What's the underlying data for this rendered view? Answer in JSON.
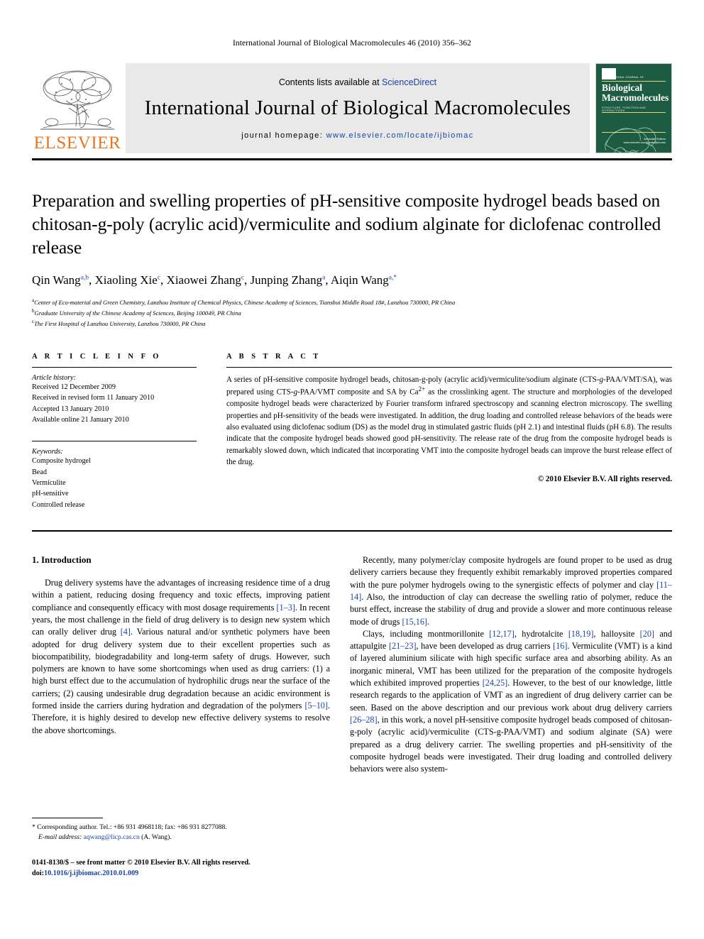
{
  "running_head": "International Journal of Biological Macromolecules 46 (2010) 356–362",
  "masthead": {
    "elsevier_wordmark": "ELSEVIER",
    "contents_prefix": "Contents lists available at ",
    "sciencedirect": "ScienceDirect",
    "journal_title": "International Journal of Biological Macromolecules",
    "homepage_prefix": "journal homepage: ",
    "homepage_url": "www.elsevier.com/locate/ijbiomac",
    "cover": {
      "top_line": "INTERNATIONAL JOURNAL OF",
      "name_line1": "Biological",
      "name_line2": "Macromolecules",
      "subtitle": "STRUCTURE, FUNCTION AND INTERACTIONS",
      "footer_line1": "Associate Editors",
      "footer_line2": "www.elsevier.com/locate/ijbiomac"
    },
    "accent_orange": "#E87722",
    "link_blue": "#1a43a8",
    "band_gray": "#e9e9e9",
    "cover_green": "#1d5c42"
  },
  "article": {
    "title": "Preparation and swelling properties of pH-sensitive composite hydrogel beads based on chitosan-g-poly (acrylic acid)/vermiculite and sodium alginate for diclofenac controlled release",
    "authors_html": "Qin Wang<sup>a,b</sup>, Xiaoling Xie<sup>c</sup>, Xiaowei Zhang<sup>c</sup>, Junping Zhang<sup>a</sup>, Aiqin Wang<sup>a,</sup><sup>*</sup>",
    "affiliations": [
      {
        "marker": "a",
        "text": "Center of Eco-material and Green Chemistry, Lanzhou Institute of Chemical Physics, Chinese Academy of Sciences, Tianshui Middle Road 18#, Lanzhou 730000, PR China"
      },
      {
        "marker": "b",
        "text": "Graduate University of the Chinese Academy of Sciences, Beijing 100049, PR China"
      },
      {
        "marker": "c",
        "text": "The First Hospital of Lanzhou University, Lanzhou 730000, PR China"
      }
    ]
  },
  "article_info": {
    "heading": "A R T I C L E    I N F O",
    "history_label": "Article history:",
    "history": [
      "Received 12 December 2009",
      "Received in revised form 11 January 2010",
      "Accepted 13 January 2010",
      "Available online 21 January 2010"
    ],
    "keywords_label": "Keywords:",
    "keywords": [
      "Composite hydrogel",
      "Bead",
      "Vermiculite",
      "pH-sensitive",
      "Controlled release"
    ]
  },
  "abstract": {
    "heading": "A B S T R A C T",
    "body_html": "A series of pH-sensitive composite hydrogel beads, chitosan-g-poly (acrylic acid)/vermiculite/sodium alginate (CTS-<i>g</i>-PAA/VMT/SA), was prepared using CTS-<i>g</i>-PAA/VMT composite and SA by Ca<sup>2+</sup> as the crosslinking agent. The structure and morphologies of the developed composite hydrogel beads were characterized by Fourier transform infrared spectroscopy and scanning electron microscopy. The swelling properties and pH-sensitivity of the beads were investigated. In addition, the drug loading and controlled release behaviors of the beads were also evaluated using diclofenac sodium (DS) as the model drug in stimulated gastric fluids (pH 2.1) and intestinal fluids (pH 6.8). The results indicate that the composite hydrogel beads showed good pH-sensitivity. The release rate of the drug from the composite hydrogel beads is remarkably slowed down, which indicated that incorporating VMT into the composite hydrogel beads can improve the burst release effect of the drug.",
    "copyright": "© 2010 Elsevier B.V. All rights reserved."
  },
  "introduction": {
    "heading": "1.  Introduction",
    "left_paragraphs_html": [
      "Drug delivery systems have the advantages of increasing residence time of a drug within a patient, reducing dosing frequency and toxic effects, improving patient compliance and consequently efficacy with most dosage requirements <span class=\"ref\">[1–3]</span>. In recent years, the most challenge in the field of drug delivery is to design new system which can orally deliver drug <span class=\"ref\">[4]</span>. Various natural and/or synthetic polymers have been adopted for drug delivery system due to their excellent properties such as biocompatibility, biodegradability and long-term safety of drugs. However, such polymers are known to have some shortcomings when used as drug carriers: (1) a high burst effect due to the accumulation of hydrophilic drugs near the surface of the carriers; (2) causing undesirable drug degradation because an acidic environment is formed inside the carriers during hydration and degradation of the polymers <span class=\"ref\">[5–10]</span>. Therefore, it is highly desired to develop new effective delivery systems to resolve the above shortcomings."
    ],
    "right_paragraphs_html": [
      "Recently, many polymer/clay composite hydrogels are found proper to be used as drug delivery carriers because they frequently exhibit remarkably improved properties compared with the pure polymer hydrogels owing to the synergistic effects of polymer and clay <span class=\"ref\">[11–14]</span>. Also, the introduction of clay can decrease the swelling ratio of polymer, reduce the burst effect, increase the stability of drug and provide a slower and more continuous release mode of drugs <span class=\"ref\">[15,16]</span>.",
      "Clays, including montmorillonite <span class=\"ref\">[12,17]</span>, hydrotalcite <span class=\"ref\">[18,19]</span>, halloysite <span class=\"ref\">[20]</span> and attapulgite <span class=\"ref\">[21–23]</span>, have been developed as drug carriers <span class=\"ref\">[16]</span>. Vermiculite (VMT) is a kind of layered aluminium silicate with high specific surface area and absorbing ability. As an inorganic mineral, VMT has been utilized for the preparation of the composite hydrogels which exhibited improved properties <span class=\"ref\">[24,25]</span>. However, to the best of our knowledge, little research regards to the application of VMT as an ingredient of drug delivery carrier can be seen. Based on the above description and our previous work about drug delivery carriers <span class=\"ref\">[26–28]</span>, in this work, a novel pH-sensitive composite hydrogel beads composed of chitosan-g-poly (acrylic acid)/vermiculite (CTS-g-PAA/VMT) and sodium alginate (SA) were prepared as a drug delivery carrier. The swelling properties and pH-sensitivity of the composite hydrogel beads were investigated. Their drug loading and controlled delivery behaviors were also system-"
    ]
  },
  "footnotes": {
    "corresponding_html": "* Corresponding author. Tel.: +86 931 4968118; fax: +86 931 8277088.<br><i>E-mail address:</i> <span class=\"mail\">aqwang@licp.cas.cn</span> (A. Wang).",
    "issn_html": "0141-8130/$ – see front matter © 2010 Elsevier B.V. All rights reserved.<br>doi:<span class=\"doi\">10.1016/j.ijbiomac.2010.01.009</span>"
  }
}
